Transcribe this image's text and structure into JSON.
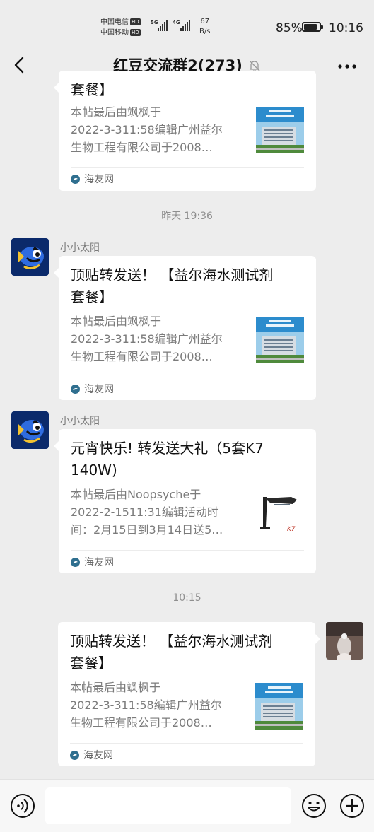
{
  "status_bar": {
    "carrier1": "中国电信",
    "carrier2": "中国移动",
    "hd": "HD",
    "net1": "5G",
    "net2": "4G",
    "speed_value": "67",
    "speed_unit": "B/s",
    "battery_pct": "85%",
    "battery_level": 0.85,
    "time": "10:16"
  },
  "nav": {
    "title": "红豆交流群2(273)",
    "back_icon": "chevron-left-icon",
    "mute_icon": "bell-off-icon",
    "more_icon": "more-horizontal-icon"
  },
  "messages": [
    {
      "title": "套餐】",
      "desc_lines": [
        "本帖最后由飒枫于",
        "2022-3-311:58编辑广州益尔",
        "生物工程有限公司于2008…"
      ],
      "source": "海友网"
    },
    {
      "timestamp": "昨天 19:36",
      "sender": "小小太阳",
      "title_lines": [
        "顶贴转发送！ 【益尔海水测试剂",
        "套餐】"
      ],
      "desc_lines": [
        "本帖最后由飒枫于",
        "2022-3-311:58编辑广州益尔",
        "生物工程有限公司于2008…"
      ],
      "source": "海友网"
    },
    {
      "sender": "小小太阳",
      "title_lines": [
        "元宵快乐! 转发送大礼（5套K7",
        "140W)"
      ],
      "desc_lines": [
        "本帖最后由Noopsyche于",
        "2022-2-1511:31编辑活动时",
        "间：2月15日到3月14日送5…"
      ],
      "source": "海友网"
    },
    {
      "timestamp": "10:15",
      "title_lines": [
        "顶贴转发送！ 【益尔海水测试剂",
        "套餐】"
      ],
      "desc_lines": [
        "本帖最后由飒枫于",
        "2022-3-311:58编辑广州益尔",
        "生物工程有限公司于2008…"
      ],
      "source": "海友网"
    }
  ],
  "input_bar": {
    "voice_icon": "voice-icon",
    "placeholder": "",
    "emoji_icon": "emoji-icon",
    "plus_icon": "plus-circle-icon"
  }
}
